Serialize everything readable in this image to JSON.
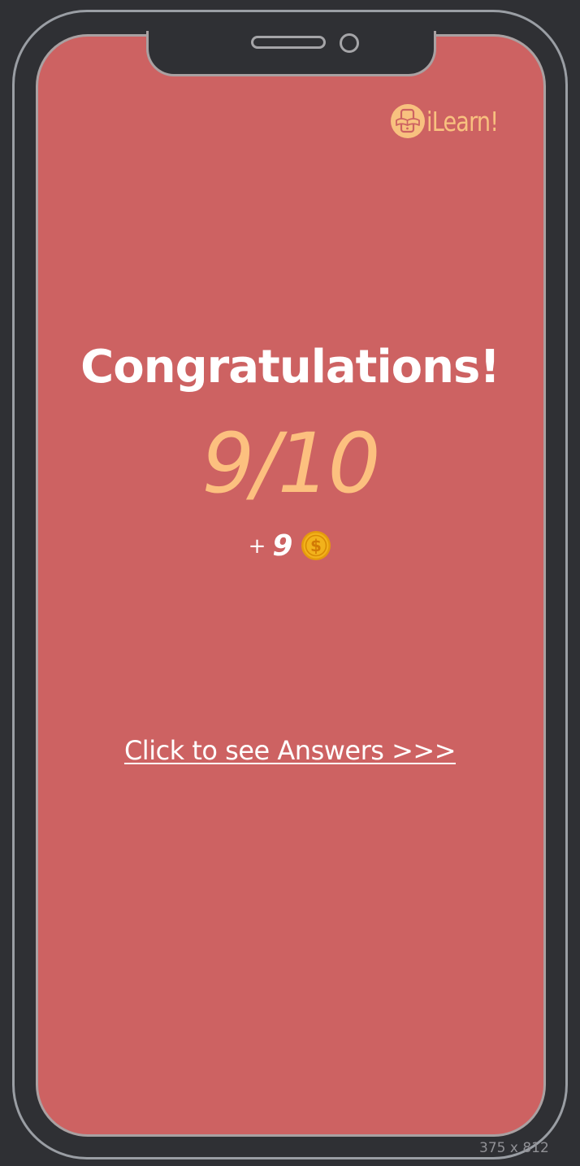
{
  "app": {
    "logo_text": "iLearn!"
  },
  "result": {
    "title": "Congratulations!",
    "score": "9/10",
    "reward_prefix": "+",
    "reward_amount": "9",
    "reward_icon": "coin-icon"
  },
  "actions": {
    "see_answers": "Click to see Answers >>>"
  },
  "device": {
    "size_label": "375 x 812"
  },
  "colors": {
    "screen_background": "#cd6262",
    "accent": "#fcc07f",
    "text": "#ffffff",
    "device_background": "#2f3034",
    "coin": "#f2b21b"
  }
}
